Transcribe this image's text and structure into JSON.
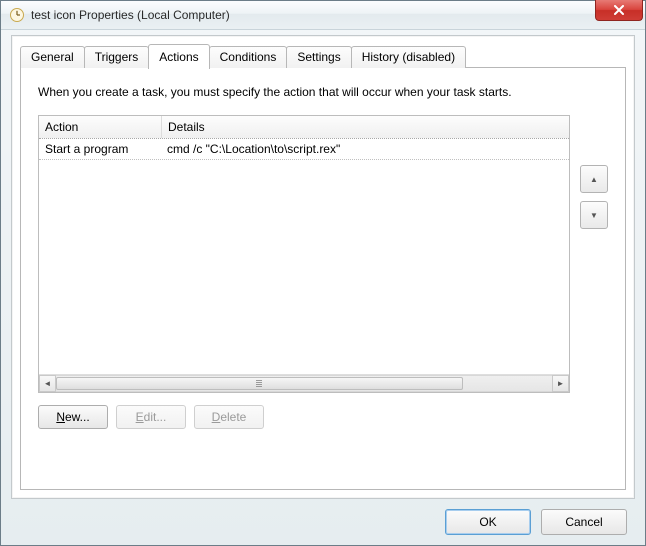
{
  "window": {
    "title": "test icon Properties (Local Computer)"
  },
  "tabs": {
    "general": "General",
    "triggers": "Triggers",
    "actions": "Actions",
    "conditions": "Conditions",
    "settings": "Settings",
    "history": "History (disabled)",
    "active": "actions"
  },
  "actionsPanel": {
    "instruction": "When you create a task, you must specify the action that will occur when your task starts.",
    "columns": {
      "action": "Action",
      "details": "Details"
    },
    "rows": [
      {
        "action": "Start a program",
        "details": "cmd /c \"C:\\Location\\to\\script.rex\""
      }
    ],
    "buttons": {
      "new_prefix": "N",
      "new_rest": "ew...",
      "edit_prefix": "E",
      "edit_rest": "dit...",
      "delete_prefix": "D",
      "delete_rest": "elete"
    },
    "moveUpGlyph": "▲",
    "moveDownGlyph": "▼"
  },
  "footer": {
    "ok": "OK",
    "cancel": "Cancel"
  },
  "closeGlyph": "×"
}
